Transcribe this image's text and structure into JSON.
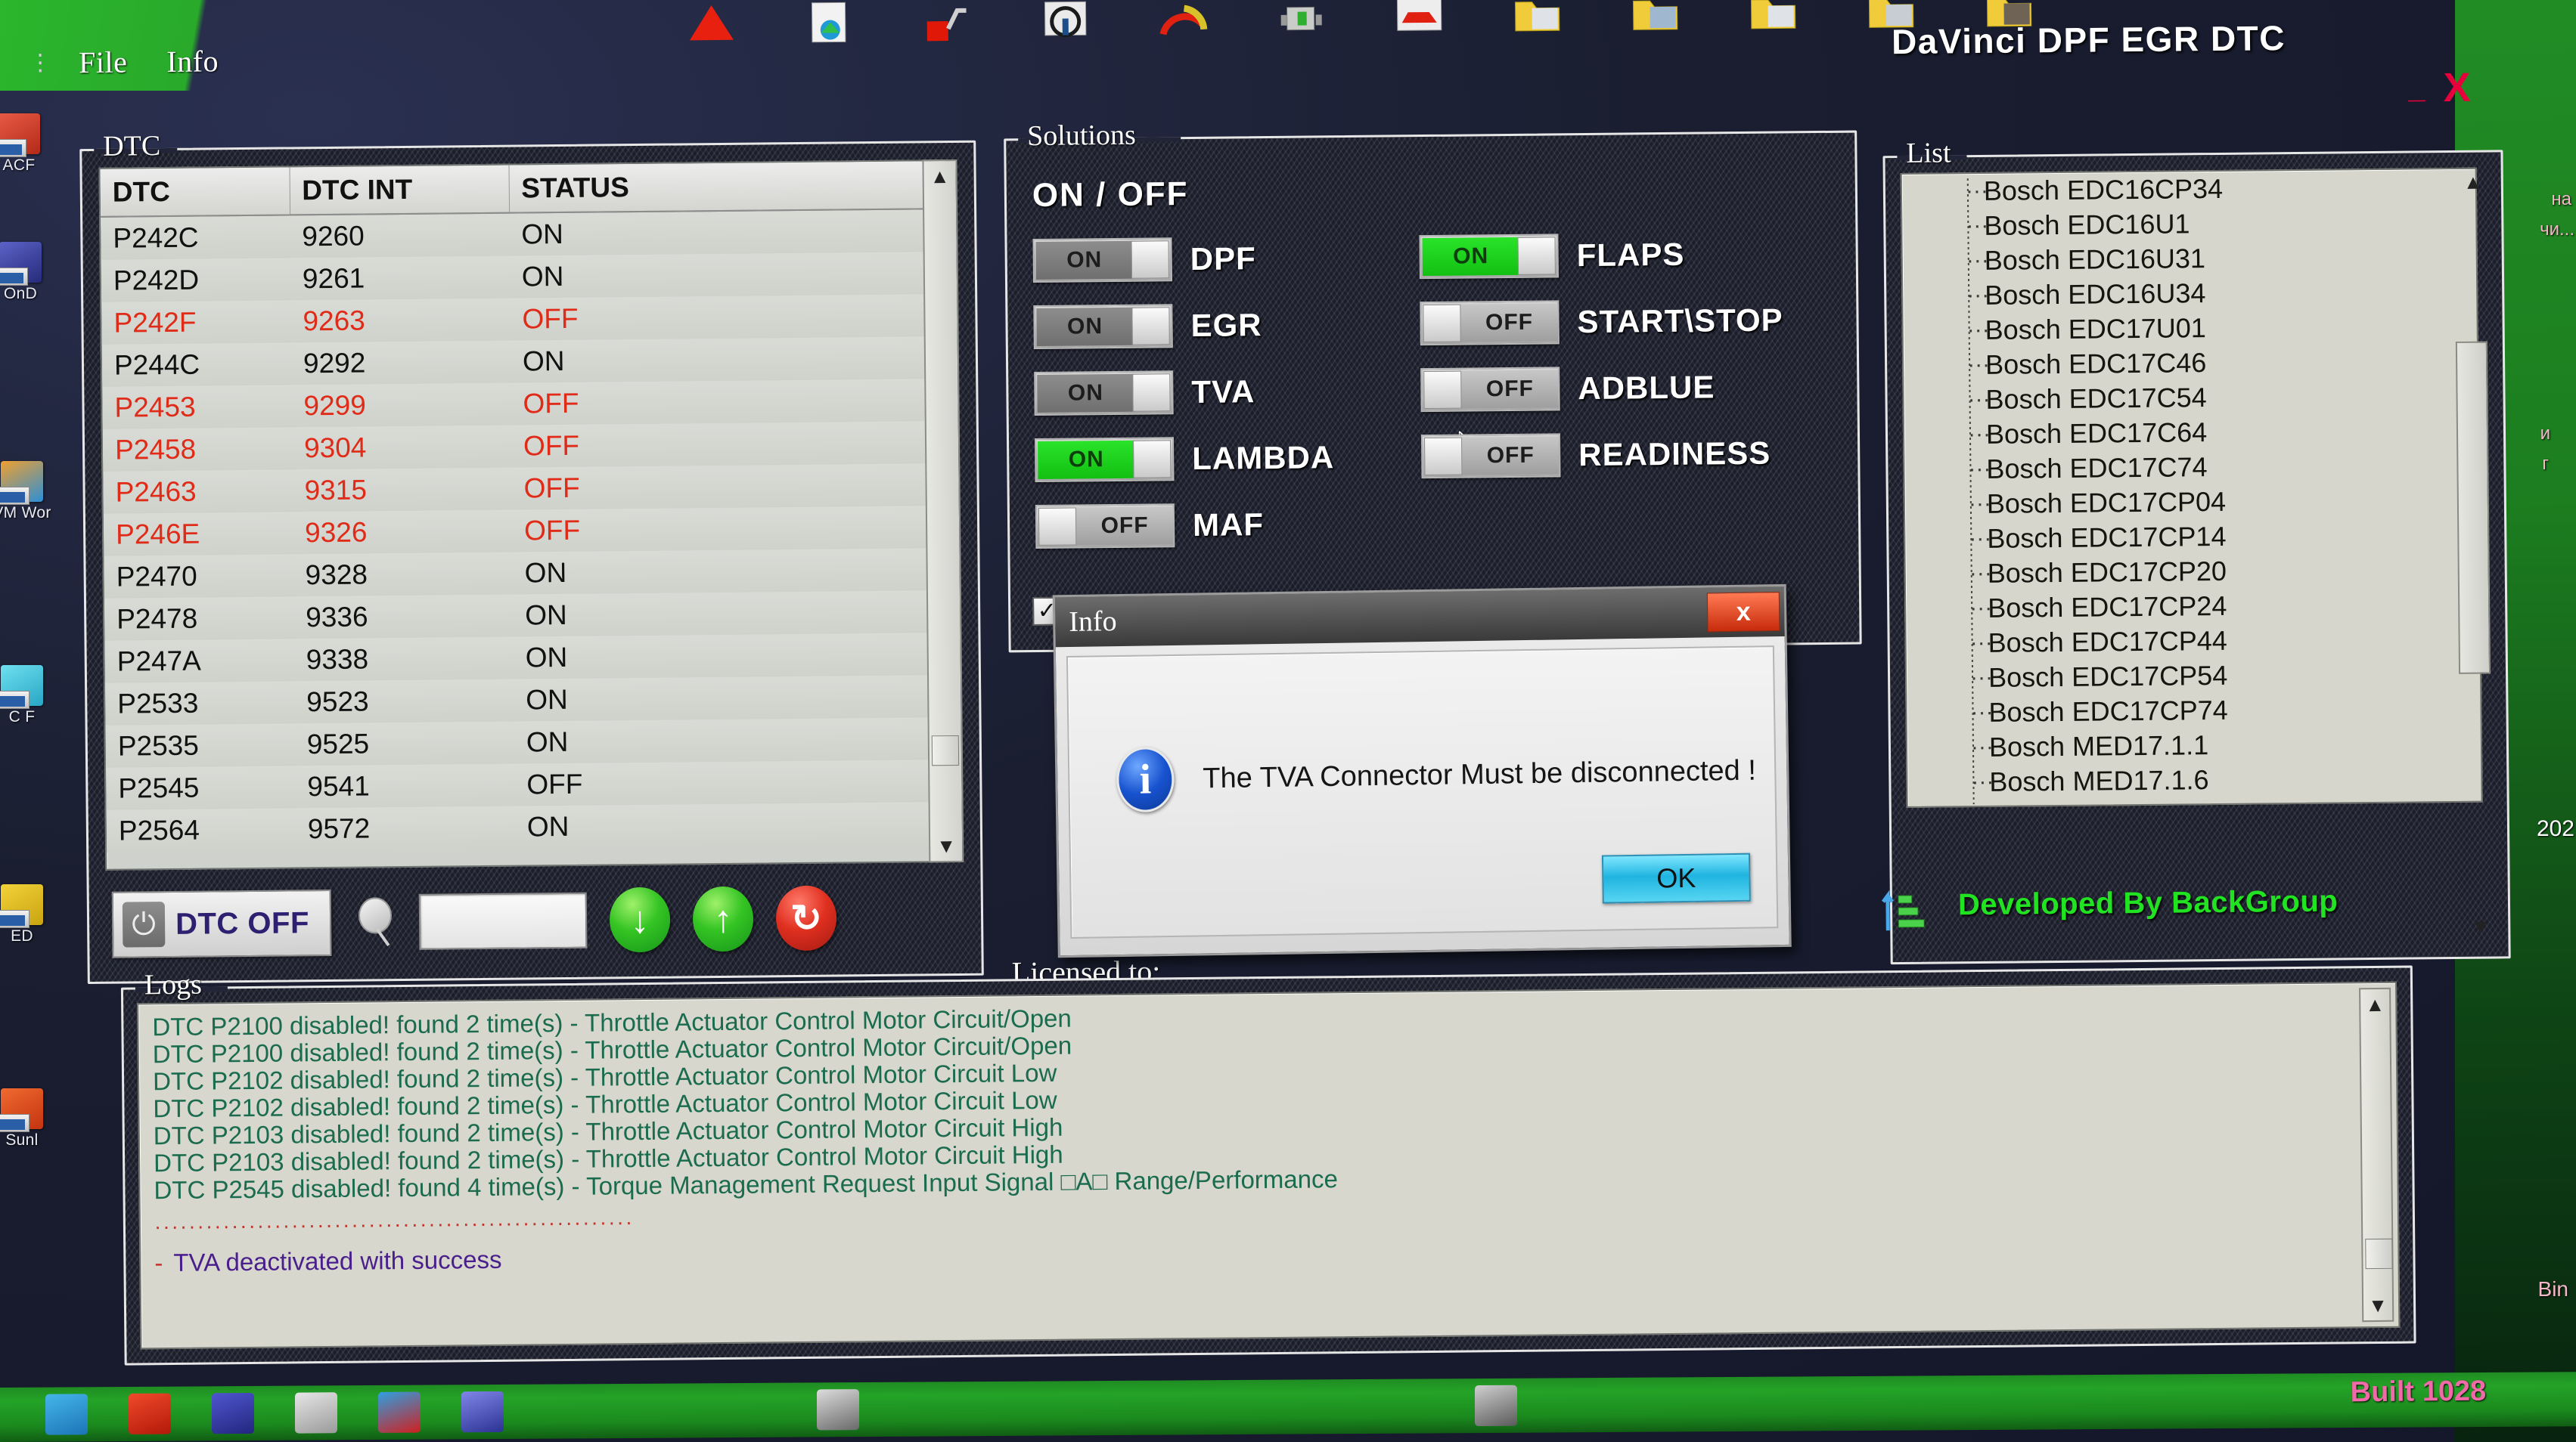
{
  "window": {
    "title": "DaVinci DPF EGR DTC",
    "minimize_label": "_",
    "close_label": "X",
    "built_label": "Built 1028",
    "developed_by": "Developed By BackGroup",
    "licensed_to": "Licensed to:"
  },
  "menu": {
    "items": [
      {
        "label": "File"
      },
      {
        "label": "Info"
      }
    ],
    "grip_icon": "drag-dots-icon"
  },
  "toolbar": {
    "icons": [
      "red-triangle-icon",
      "document-globe-icon",
      "red-connector-icon",
      "steering-wheel-icon",
      "gauge-icon",
      "engine-icon",
      "car-red-icon",
      "folder-icon-1",
      "folder-icon-2",
      "folder-icon-3",
      "folder-icon-4",
      "folder-icon-5"
    ]
  },
  "dtc_panel": {
    "legend": "DTC",
    "columns": [
      "DTC",
      "DTC INT",
      "STATUS"
    ],
    "rows": [
      {
        "dtc": "P242C",
        "int": "9260",
        "status": "ON",
        "off": false
      },
      {
        "dtc": "P242D",
        "int": "9261",
        "status": "ON",
        "off": false
      },
      {
        "dtc": "P242F",
        "int": "9263",
        "status": "OFF",
        "off": true
      },
      {
        "dtc": "P244C",
        "int": "9292",
        "status": "ON",
        "off": false
      },
      {
        "dtc": "P2453",
        "int": "9299",
        "status": "OFF",
        "off": true
      },
      {
        "dtc": "P2458",
        "int": "9304",
        "status": "OFF",
        "off": true
      },
      {
        "dtc": "P2463",
        "int": "9315",
        "status": "OFF",
        "off": true
      },
      {
        "dtc": "P246E",
        "int": "9326",
        "status": "OFF",
        "off": true
      },
      {
        "dtc": "P2470",
        "int": "9328",
        "status": "ON",
        "off": false
      },
      {
        "dtc": "P2478",
        "int": "9336",
        "status": "ON",
        "off": false
      },
      {
        "dtc": "P247A",
        "int": "9338",
        "status": "ON",
        "off": false
      },
      {
        "dtc": "P2533",
        "int": "9523",
        "status": "ON",
        "off": false
      },
      {
        "dtc": "P2535",
        "int": "9525",
        "status": "ON",
        "off": false
      },
      {
        "dtc": "P2545",
        "int": "9541",
        "status": "OFF",
        "off": false
      },
      {
        "dtc": "P2564",
        "int": "9572",
        "status": "ON",
        "off": false
      }
    ],
    "controls": {
      "dtc_off_label": "DTC OFF",
      "power_icon": "power-icon",
      "search_icon": "search-magnifier-icon",
      "search_value": "",
      "search_placeholder": "",
      "download_icon": "download-arrow-icon",
      "upload_icon": "upload-arrow-icon",
      "reset_icon": "reset-refresh-icon"
    },
    "scrollbar": {
      "up": "▲",
      "down": "▼"
    }
  },
  "solutions_panel": {
    "legend": "Solutions",
    "heading": "ON / OFF",
    "left_switches": [
      {
        "label": "DPF",
        "state": "ON",
        "lit": false
      },
      {
        "label": "EGR",
        "state": "ON",
        "lit": false
      },
      {
        "label": "TVA",
        "state": "ON",
        "lit": false
      },
      {
        "label": "LAMBDA",
        "state": "ON",
        "lit": true
      },
      {
        "label": "MAF",
        "state": "OFF",
        "lit": false
      }
    ],
    "right_switches": [
      {
        "label": "FLAPS",
        "state": "ON",
        "lit": true
      },
      {
        "label": "START\\STOP",
        "state": "OFF",
        "lit": false
      },
      {
        "label": "ADBLUE",
        "state": "OFF",
        "lit": false
      },
      {
        "label": "READINESS",
        "state": "OFF",
        "lit": false
      }
    ],
    "checkbox_checked": "✓",
    "cursor_icon": "mouse-pointer-icon"
  },
  "list_panel": {
    "legend": "List",
    "items": [
      "Bosch EDC16CP34",
      "Bosch EDC16U1",
      "Bosch EDC16U31",
      "Bosch EDC16U34",
      "Bosch EDC17U01",
      "Bosch EDC17C46",
      "Bosch EDC17C54",
      "Bosch EDC17C64",
      "Bosch EDC17C74",
      "Bosch EDC17CP04",
      "Bosch EDC17CP14",
      "Bosch EDC17CP20",
      "Bosch EDC17CP24",
      "Bosch EDC17CP44",
      "Bosch EDC17CP54",
      "Bosch EDC17CP74",
      "Bosch MED17.1.1",
      "Bosch MED17.1.6"
    ],
    "scrollbar": {
      "up": "▲",
      "down": "▼"
    }
  },
  "logs_panel": {
    "legend": "Logs",
    "lines": [
      "DTC P2100 disabled! found 2 time(s) - Throttle Actuator Control Motor Circuit/Open",
      "DTC P2100 disabled! found 2 time(s) - Throttle Actuator Control Motor Circuit/Open",
      "DTC P2102 disabled! found 2 time(s) - Throttle Actuator Control Motor Circuit Low",
      "DTC P2102 disabled! found 2 time(s) - Throttle Actuator Control Motor Circuit Low",
      "DTC P2103 disabled! found 2 time(s) - Throttle Actuator Control Motor Circuit High",
      "DTC P2103 disabled! found 2 time(s) - Throttle Actuator Control Motor Circuit High",
      "DTC P2545 disabled! found 4 time(s) - Torque Management Request Input Signal □A□ Range/Performance"
    ],
    "separator": "························································",
    "success_bullet": "-",
    "success_line": "TVA deactivated with success"
  },
  "dialog": {
    "title": "Info",
    "close_label": "x",
    "icon": "info-circle-icon",
    "message": "The TVA Connector Must be disconnected !",
    "ok_label": "OK"
  },
  "desktop": {
    "icons": [
      {
        "label": "ACF",
        "color": "#d83a2a"
      },
      {
        "label": "OnD",
        "color": "#3a3f9e"
      },
      {
        "label": "VM Wor",
        "color": "#e08a20"
      },
      {
        "label": "C F",
        "color": "#41c4d8"
      },
      {
        "label": "ED",
        "color": "#e0c020"
      },
      {
        "label": "Sunl",
        "color": "#e04a20"
      }
    ],
    "right_labels": [
      "на",
      "чи...",
      "и",
      "г",
      "202",
      "Bin"
    ]
  },
  "colors": {
    "accent_green": "#22e322",
    "error_red": "#e02b18",
    "log_green": "#1b6b4e",
    "log_purple": "#4a1f8c",
    "built_pink": "#f06aa8",
    "switch_on": "#12c012"
  }
}
